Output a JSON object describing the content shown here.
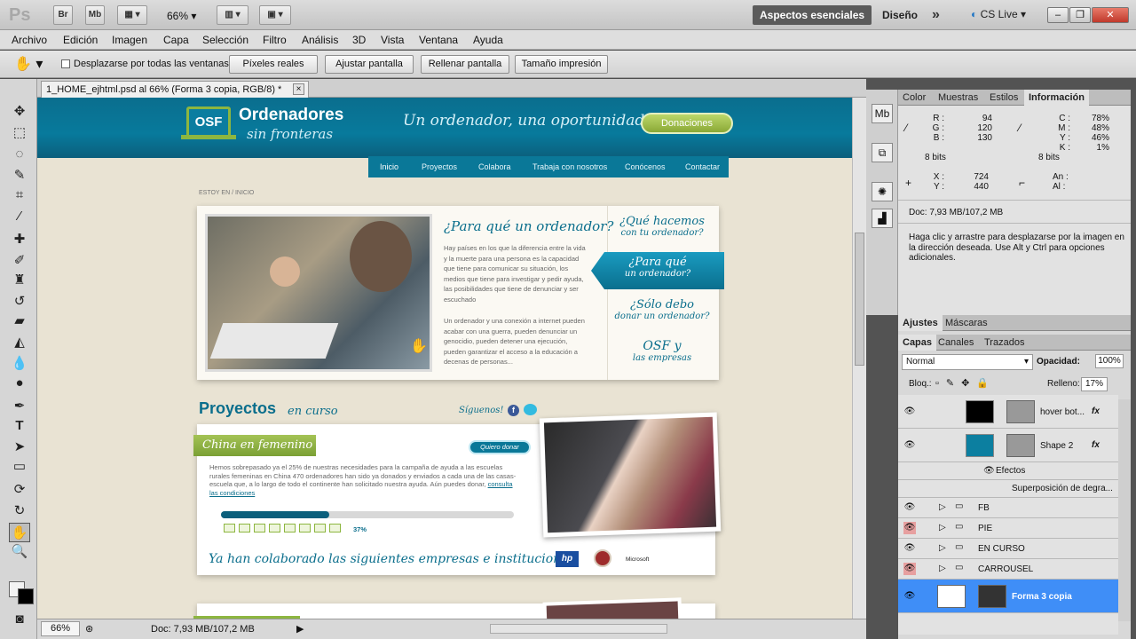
{
  "app": {
    "logo": "Ps"
  },
  "appbar": {
    "br": "Br",
    "mb": "Mb",
    "zoom": "66%",
    "workspace_active": "Aspectos esenciales",
    "workspace_other": "Diseño",
    "more": "»",
    "cslive": "CS Live"
  },
  "menu": [
    "Archivo",
    "Edición",
    "Imagen",
    "Capa",
    "Selección",
    "Filtro",
    "Análisis",
    "3D",
    "Vista",
    "Ventana",
    "Ayuda"
  ],
  "options": {
    "scroll_all_label": "Desplazarse por todas las ventanas",
    "buttons": [
      "Píxeles reales",
      "Ajustar pantalla",
      "Rellenar pantalla",
      "Tamaño impresión"
    ]
  },
  "document": {
    "tab_title": "1_HOME_ejhtml.psd al 66% (Forma 3 copia, RGB/8) *",
    "close": "×"
  },
  "status": {
    "zoom": "66%",
    "doc": "Doc: 7,93 MB/107,2 MB"
  },
  "site": {
    "logo_badge": "OSF",
    "logo_title": "Ordenadores",
    "logo_sub": "sin fronteras",
    "tagline": "Un ordenador, una oportunidad",
    "donate": "Donaciones",
    "nav": [
      "Inicio",
      "Proyectos",
      "Colabora",
      "Trabaja con nosotros",
      "Conócenos",
      "Contactar"
    ],
    "breadcrumb": "ESTOY EN / INICIO",
    "hero_title": "¿Para qué un ordenador?",
    "hero_p1": "Hay países en los que la diferencia entre la vida y la muerte para una persona es la capacidad que tiene para comunicar su situación, los medios que tiene para investigar y pedir ayuda, las posibilidades que tiene de denunciar y ser escuchado",
    "hero_p2": "Un ordenador y una conexión a internet pueden acabar con una guerra, pueden denunciar un genocidio, pueden detener una ejecución, pueden garantizar el acceso a la educación a decenas de personas...",
    "side": [
      {
        "title": "¿Qué hacemos",
        "sub": "con tu ordenador?"
      },
      {
        "title": "¿Para qué",
        "sub": "un ordenador?"
      },
      {
        "title": "¿Sólo debo",
        "sub": "donar un ordenador?"
      },
      {
        "title": "OSF y",
        "sub": "las empresas"
      }
    ],
    "projects_title": "Proyectos",
    "projects_sub": "en curso",
    "follow": "Síguenos!",
    "project_name": "China en femenino",
    "project_btn": "Quiero donar",
    "project_text": "Hemos sobrepasado ya el 25% de nuestras necesidades para la campaña de ayuda a las escuelas rurales femeninas en China 470 ordenadores han sido ya donados y enviados a cada una de las casas-escuela que, a lo largo de todo el continente han solicitado nuestra ayuda. Aún puedes donar,",
    "project_link": "consulta las condiciones",
    "progress": 0.37,
    "progress_label": "37%",
    "partners": "Ya han colaborado las siguientes empresas e instituciones:",
    "partner_hp": "hp",
    "partner_ms": "Microsoft"
  },
  "info_panel": {
    "tabs": [
      "Color",
      "Muestras",
      "Estilos",
      "Información"
    ],
    "r": "R :",
    "g": "G :",
    "b": "B :",
    "rv": "94",
    "gv": "120",
    "bv": "130",
    "c": "C :",
    "m": "M :",
    "y": "Y :",
    "k": "K :",
    "cv": "78%",
    "mv": "48%",
    "yv": "46%",
    "kv": "1%",
    "bits1": "8 bits",
    "bits2": "8 bits",
    "x": "X :",
    "yy": "Y :",
    "xv": "724",
    "yyv": "440",
    "an": "An :",
    "al": "Al :",
    "doc": "Doc: 7,93 MB/107,2 MB",
    "hint": "Haga clic y arrastre para desplazarse por la imagen en la dirección deseada. Use Alt y Ctrl para opciones adicionales."
  },
  "adjust_tabs": [
    "Ajustes",
    "Máscaras"
  ],
  "layers_panel": {
    "tabs": [
      "Capas",
      "Canales",
      "Trazados"
    ],
    "blend": "Normal",
    "opacity_label": "Opacidad:",
    "opacity": "100%",
    "lock_label": "Bloq.:",
    "fill_label": "Relleno:",
    "fill": "17%",
    "rows": [
      {
        "name": "hover bot...",
        "fx": "fx"
      },
      {
        "name": "Shape 2",
        "fx": "fx"
      },
      {
        "name": "Efectos"
      },
      {
        "name": "Superposición de degra..."
      },
      {
        "name": "FB"
      },
      {
        "name": "PIE"
      },
      {
        "name": "EN CURSO"
      },
      {
        "name": "CARROUSEL"
      },
      {
        "name": "Forma 3 copia"
      }
    ]
  },
  "colors": {
    "accent": "#0a7898",
    "selection": "#3f8ef7",
    "green": "#8db640"
  }
}
